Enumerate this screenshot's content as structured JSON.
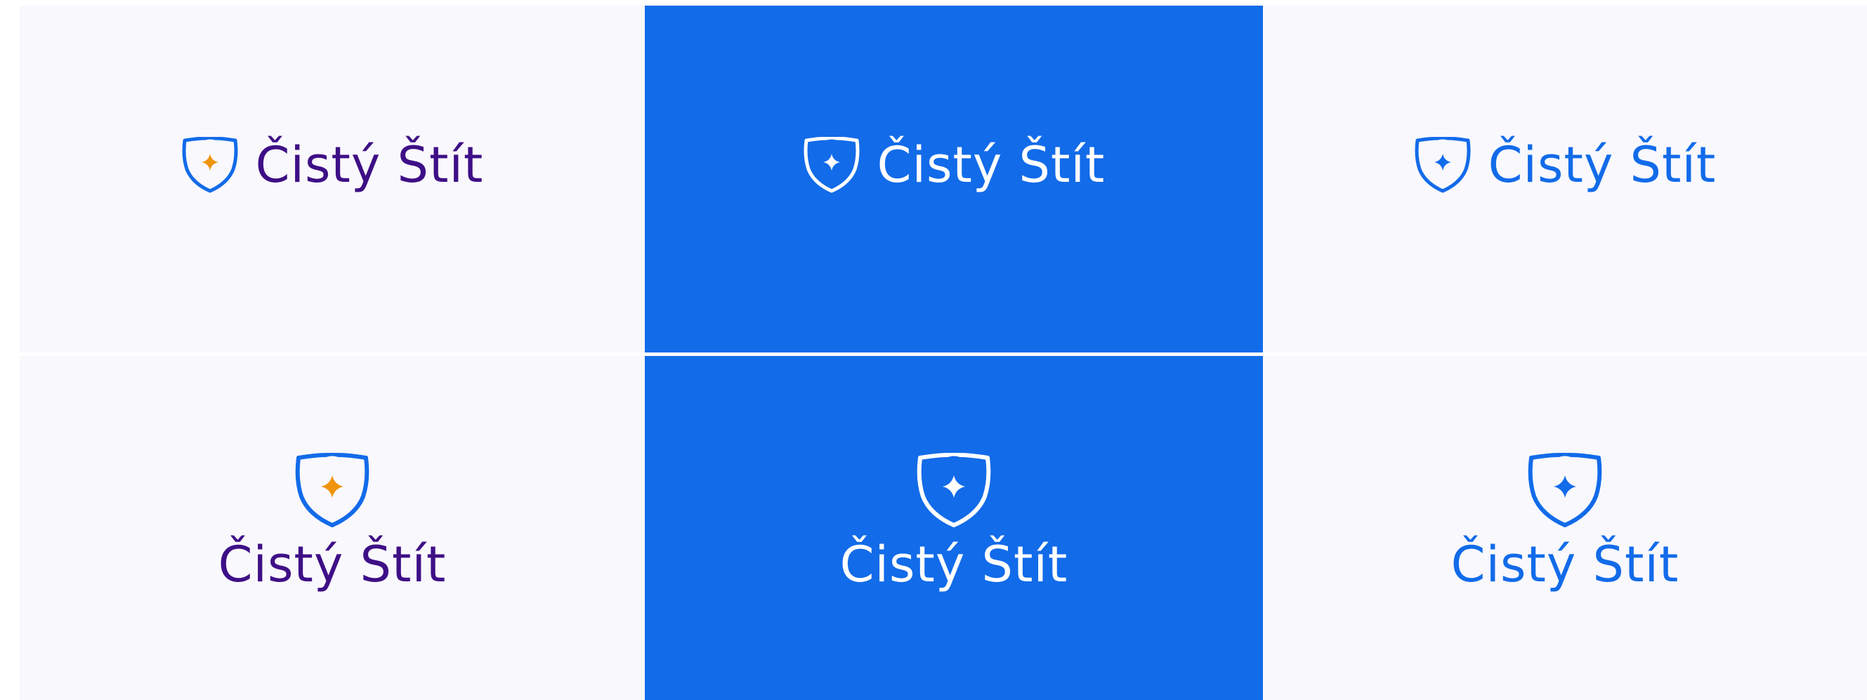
{
  "brand": {
    "name": "Čistý Štít"
  },
  "colors": {
    "light_background": "#f9f8fd",
    "blue_background": "#126be9",
    "brand_blue": "#126be9",
    "brand_purple": "#3e0f86",
    "spark_orange": "#f0940e",
    "white": "#ffffff"
  },
  "variants": [
    {
      "layout": "horizontal",
      "background": "light",
      "shield": "brand_blue",
      "spark": "spark_orange",
      "wordmark": "brand_purple"
    },
    {
      "layout": "horizontal",
      "background": "blue",
      "shield": "white",
      "spark": "white",
      "wordmark": "white"
    },
    {
      "layout": "horizontal",
      "background": "light",
      "shield": "brand_blue",
      "spark": "brand_blue",
      "wordmark": "brand_blue"
    },
    {
      "layout": "stacked",
      "background": "light",
      "shield": "brand_blue",
      "spark": "spark_orange",
      "wordmark": "brand_purple"
    },
    {
      "layout": "stacked",
      "background": "blue",
      "shield": "white",
      "spark": "white",
      "wordmark": "white"
    },
    {
      "layout": "stacked",
      "background": "light",
      "shield": "brand_blue",
      "spark": "brand_blue",
      "wordmark": "brand_blue"
    }
  ],
  "icons": {
    "shield": "shield-icon",
    "spark": "sparkle-icon"
  }
}
